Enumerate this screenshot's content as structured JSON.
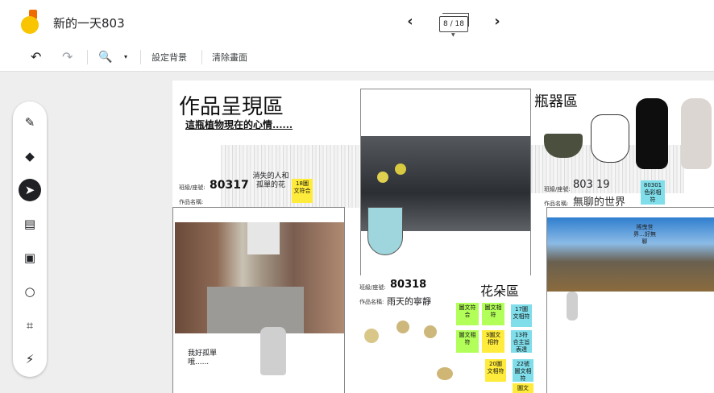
{
  "app": {
    "title": "新的一天803"
  },
  "nav": {
    "prev": "‹",
    "next": "›",
    "page_indicator": "8 / 18"
  },
  "toolbar": {
    "set_background": "設定背景",
    "clear_frame": "清除畫面"
  },
  "icons": [
    "logo-icon",
    "undo-icon",
    "redo-icon",
    "zoom-icon",
    "chevron-down-icon",
    "pen-icon",
    "eraser-icon",
    "select-arrow-icon",
    "sticky-note-icon",
    "image-icon",
    "circle-icon",
    "text-box-icon",
    "laser-icon"
  ],
  "canvas": {
    "section1": {
      "title": "作品呈現區",
      "subtitle": "這瓶植物現在的心情......",
      "class_seat_label": "班級/座號:",
      "class_seat": "80317",
      "work_name_label": "作品名稱:",
      "work_name": "消失的人和孤單的花",
      "note": "18圖文符合",
      "caption": "我好孤單哦......"
    },
    "section2": {
      "class_seat_label": "班級/座號:",
      "class_seat": "80318",
      "work_name_label": "作品名稱:",
      "work_name": "雨天的寧靜"
    },
    "section3": {
      "title": "瓶器區",
      "class_seat_label": "班級/座號:",
      "class_seat": "803 19",
      "work_name_label": "作品名稱:",
      "work_name": "無聊的世界",
      "note": "80301色彩相符",
      "overlay": "搖曳世界…好無聊"
    },
    "section4": {
      "title": "花朵區",
      "notes": [
        "圖文符合",
        "圖文相符",
        "17圖文相符",
        "圖文相符",
        "3圖文相符",
        "13符合主旨表達",
        "20圖文相符",
        "22號 圖文相符",
        "圖文"
      ]
    }
  },
  "colors": {
    "accent": "#202124",
    "note_yellow": "#ffeb3b",
    "note_green": "#b2ff59",
    "note_cyan": "#80deea",
    "logo_yellow": "#f9c400",
    "logo_orange": "#ef6c00"
  }
}
